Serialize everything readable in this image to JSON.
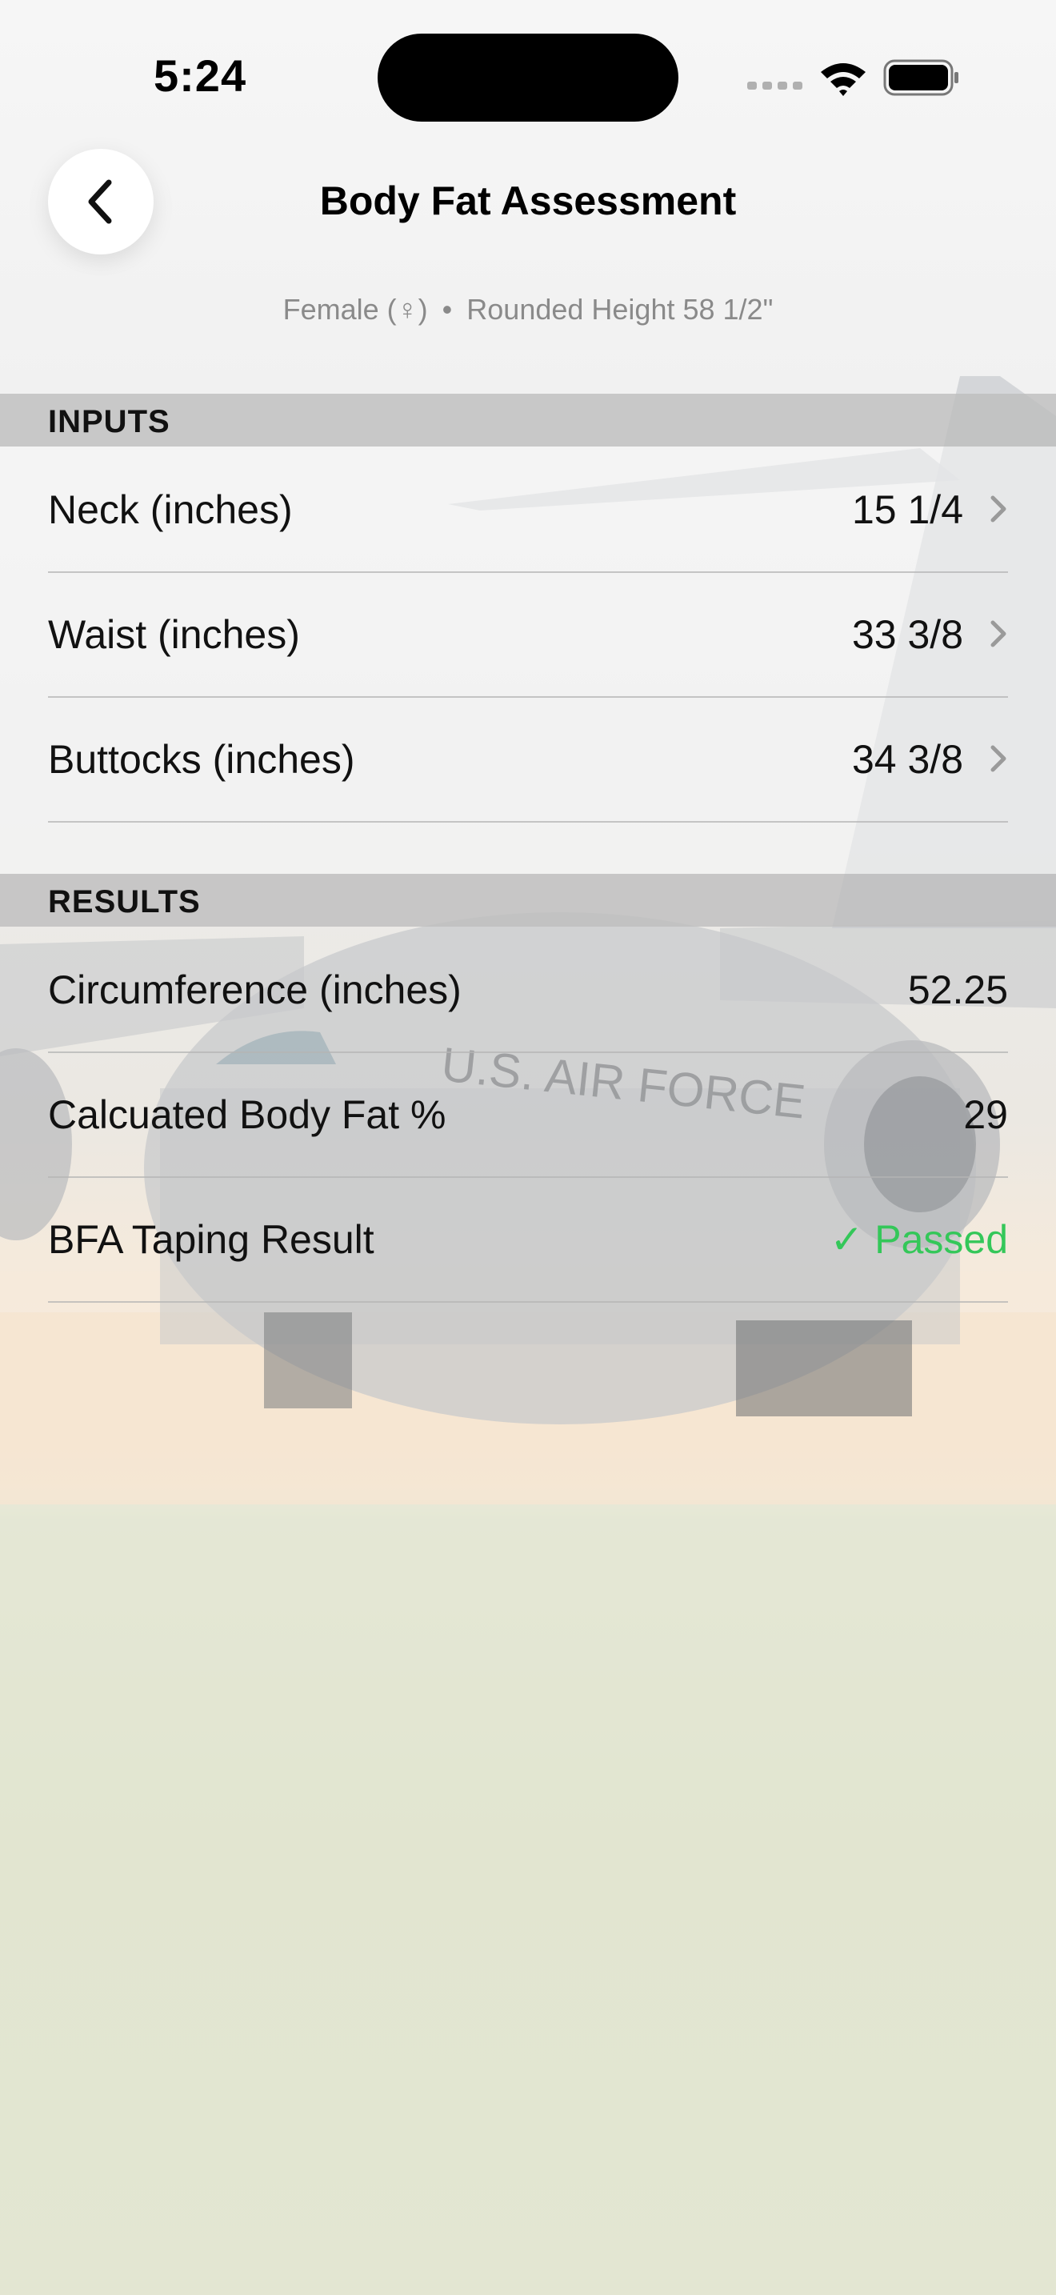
{
  "status_bar": {
    "time": "5:24"
  },
  "header": {
    "title": "Body Fat Assessment",
    "subtitle_gender": "Female (♀)",
    "subtitle_separator": "•",
    "subtitle_height": "Rounded Height 58 1/2\""
  },
  "inputs": {
    "section_label": "INPUTS",
    "rows": [
      {
        "label": "Neck (inches)",
        "value": "15 1/4"
      },
      {
        "label": "Waist (inches)",
        "value": "33 3/8"
      },
      {
        "label": "Buttocks (inches)",
        "value": "34 3/8"
      }
    ]
  },
  "results": {
    "section_label": "RESULTS",
    "rows": [
      {
        "label": "Circumference (inches)",
        "value": "52.25"
      },
      {
        "label": "Calcuated Body Fat %",
        "value": "29"
      },
      {
        "label": "BFA Taping Result",
        "value": "✓ Passed"
      }
    ]
  },
  "background_image": {
    "aircraft_text": "U.S. AIR FORCE"
  },
  "colors": {
    "passed": "#34c759",
    "section_header": "#bebebe"
  }
}
